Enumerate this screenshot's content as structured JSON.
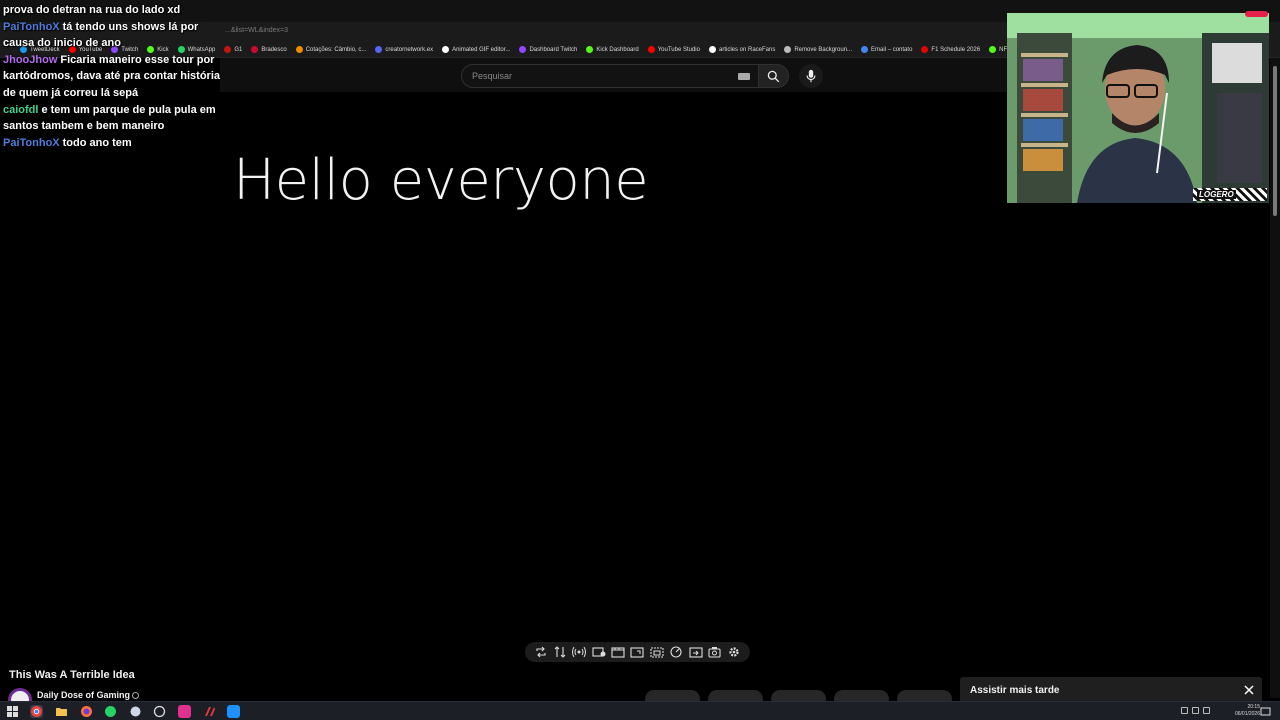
{
  "browser": {
    "url": "...&list=WL&index=3",
    "bookmarks": [
      {
        "label": "TweetDeck",
        "color": "#1d9bf0"
      },
      {
        "label": "YouTube",
        "color": "#ff0000"
      },
      {
        "label": "Twitch",
        "color": "#9146ff"
      },
      {
        "label": "Kick",
        "color": "#53fc18"
      },
      {
        "label": "WhatsApp",
        "color": "#25d366"
      },
      {
        "label": "G1",
        "color": "#c4170c"
      },
      {
        "label": "Bradesco",
        "color": "#cc092f"
      },
      {
        "label": "Cotações: Câmbio, c...",
        "color": "#f28b00"
      },
      {
        "label": "creatornetwork.ex",
        "color": "#5865f2"
      },
      {
        "label": "Animated GIF editor...",
        "color": "#ffffff"
      },
      {
        "label": "Dashboard Twitch",
        "color": "#9146ff"
      },
      {
        "label": "Kick Dashboard",
        "color": "#53fc18"
      },
      {
        "label": "YouTube Studio",
        "color": "#ff0000"
      },
      {
        "label": "articles on RaceFans",
        "color": "#ffffff"
      },
      {
        "label": "Remove Backgroun...",
        "color": "#bbbbbb"
      },
      {
        "label": "Email – contato",
        "color": "#4285f4"
      },
      {
        "label": "F1 Schedule 2026",
        "color": "#e10600"
      },
      {
        "label": "NFS",
        "color": "#53fc18"
      }
    ]
  },
  "youtube": {
    "search_placeholder": "Pesquisar",
    "video_text": "Hello everyone",
    "video_title": "This Was A Terrible Idea",
    "channel_name": "Daily Dose of Gaming",
    "watch_later_label": "Assistir mais tarde"
  },
  "chat": [
    {
      "user": "",
      "user_color": "#ffffff",
      "text": "prova do detran na rua do lado xd"
    },
    {
      "user": "PaiTonhoX",
      "user_color": "#4f7ddc",
      "text": "tá tendo uns shows lá por causa do inicio de ano"
    },
    {
      "user": "JhooJhow",
      "user_color": "#b46cf0",
      "text": "Ficaria maneiro esse tour por kartódromos, dava até pra contar história de quem já correu lá sepá"
    },
    {
      "user": "caiofdl",
      "user_color": "#3fcf8e",
      "text": "e tem um parque de pula pula em santos tambem e bem maneiro"
    },
    {
      "user": "PaiTonhoX",
      "user_color": "#4f7ddc",
      "text": "todo ano tem"
    }
  ],
  "webcam": {
    "logo_text": "LOGERO"
  },
  "taskbar": {
    "time": "20:15",
    "date": "06/01/2026"
  }
}
